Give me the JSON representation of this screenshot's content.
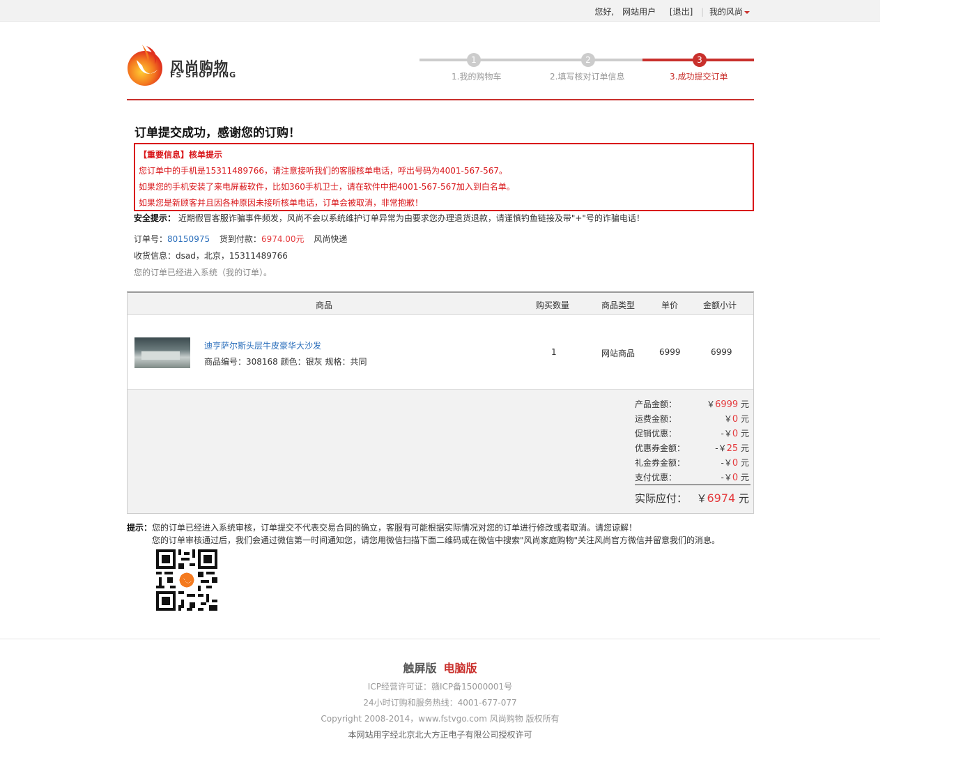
{
  "topbar": {
    "greeting": "您好,",
    "user": "网站用户",
    "logout": "[退出]",
    "my_account": "我的风尚"
  },
  "logo": {
    "cn": "风尚购物",
    "en": "FS SHOPPING"
  },
  "steps": [
    {
      "num": "1",
      "label": "1.我的购物车",
      "state": "done"
    },
    {
      "num": "2",
      "label": "2.填写核对订单信息",
      "state": "done"
    },
    {
      "num": "3",
      "label": "3.成功提交订单",
      "state": "active"
    }
  ],
  "title": "订单提交成功，感谢您的订购！",
  "notice": {
    "head": "【重要信息】核单提示",
    "lines": [
      "您订单中的手机是15311489766，请注意接听我们的客服核单电话，呼出号码为4001-567-567。",
      "如果您的手机安装了来电屏蔽软件，比如360手机卫士，请在软件中把4001-567-567加入到白名单。",
      "如果您是新顾客并且因各种原因未接听核单电话，订单会被取消，非常抱歉！"
    ]
  },
  "safe": {
    "label": "安全提示：",
    "text": " 近期假冒客服诈骗事件频发，风尚不会以系统维护订单异常为由要求您办理退货退款，请谨慎钓鱼链接及带\"+\"号的诈骗电话！"
  },
  "order": {
    "no_label": "订单号：",
    "no": "80150975",
    "pay_label": "货到付款：",
    "pay": "6974.00元",
    "shipping": "风尚快递",
    "address_label": "收货信息：",
    "address": "dsad，北京，15311489766",
    "status_pre": "您的订单已经进入系统（",
    "status_link": "我的订单",
    "status_post": "）。"
  },
  "table": {
    "headers": [
      "商品",
      "购买数量",
      "商品类型",
      "单价",
      "金额小计"
    ],
    "rows": [
      {
        "name": "迪亨萨尔斯头层牛皮豪华大沙发",
        "spec": "商品编号：308168  颜色：银灰 规格：共同",
        "qty": "1",
        "type": "网站商品",
        "price": "6999",
        "subtotal": "6999"
      }
    ]
  },
  "summary": [
    {
      "label": "产品金额：",
      "prefix": "￥",
      "value": "6999",
      "unit": "元"
    },
    {
      "label": "运费金额：",
      "prefix": "￥",
      "value": "0",
      "unit": "元"
    },
    {
      "label": "促销优惠：",
      "prefix": "-￥",
      "value": "0",
      "unit": "元"
    },
    {
      "label": "优惠券金额：",
      "prefix": "-￥",
      "value": "25",
      "unit": "元"
    },
    {
      "label": "礼金券金额：",
      "prefix": "-￥",
      "value": "0",
      "unit": "元"
    },
    {
      "label": "支付优惠：",
      "prefix": "-￥",
      "value": "0",
      "unit": "元"
    }
  ],
  "total": {
    "label": "实际应付：",
    "prefix": "￥",
    "value": "6974",
    "unit": "元"
  },
  "tips": {
    "label": "提示：",
    "line1": "您的订单已经进入系统审核，订单提交不代表交易合同的确立，客服有可能根据实际情况对您的订单进行修改或者取消。请您谅解！",
    "line2": "您的订单审核通过后，我们会通过微信第一时间通知您，请您用微信扫描下面二维码或在微信中搜索\"风尚家庭购物\"关注风尚官方微信并留意我们的消息。"
  },
  "footer": {
    "touch": "触屏版",
    "pc": "电脑版",
    "icp": "ICP经营许可证：赣ICP备15000001号",
    "hotline": "24小时订购和服务热线：4001-677-077",
    "copyright_pre": "Copyright 2008-2014，",
    "copyright_site": "www.fstvgo.com",
    "copyright_post": " 风尚购物 版权所有",
    "font_license": "本网站用字经北京北大方正电子有限公司授权许可"
  },
  "colors": {
    "accent": "#c9302c",
    "link": "#2a6ebb",
    "price": "#e4393c"
  }
}
